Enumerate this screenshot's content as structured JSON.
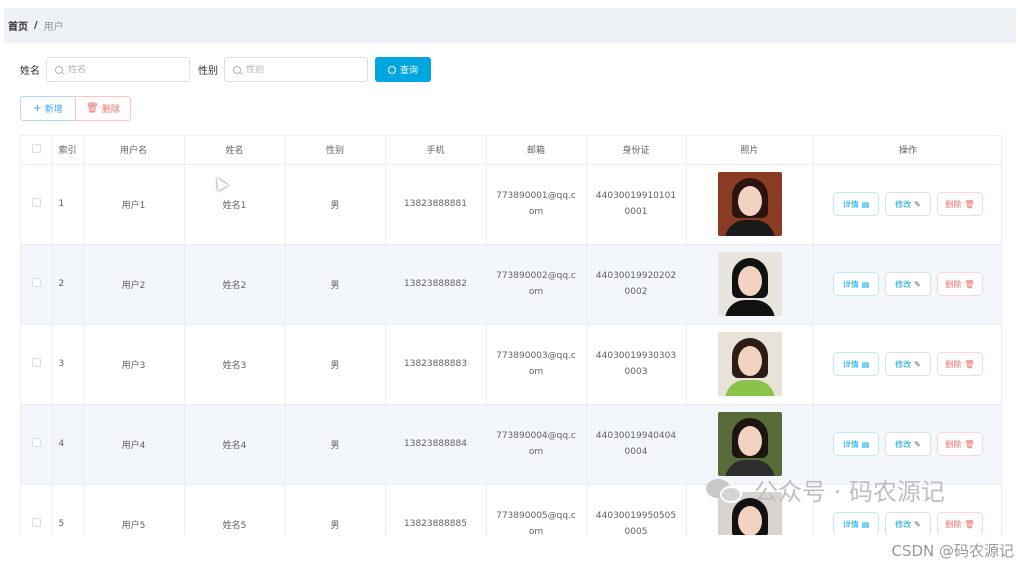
{
  "breadcrumb": {
    "home": "首页",
    "separator": "/",
    "current": "用户"
  },
  "search": {
    "name_label": "姓名",
    "name_placeholder": "姓名",
    "gender_label": "性别",
    "gender_placeholder": "性别",
    "query_label": "查询"
  },
  "actions": {
    "add_label": "新增",
    "delete_label": "删除"
  },
  "table": {
    "columns": [
      "索引",
      "用户名",
      "姓名",
      "性别",
      "手机",
      "邮箱",
      "身份证",
      "照片",
      "操作"
    ],
    "rows": [
      {
        "index": "1",
        "username": "用户1",
        "name": "姓名1",
        "gender": "男",
        "phone": "13823888881",
        "email": "773890001@qq.com",
        "idcard": "440300199101010001"
      },
      {
        "index": "2",
        "username": "用户2",
        "name": "姓名2",
        "gender": "男",
        "phone": "13823888882",
        "email": "773890002@qq.com",
        "idcard": "440300199202020002"
      },
      {
        "index": "3",
        "username": "用户3",
        "name": "姓名3",
        "gender": "男",
        "phone": "13823888883",
        "email": "773890003@qq.com",
        "idcard": "440300199303030003"
      },
      {
        "index": "4",
        "username": "用户4",
        "name": "姓名4",
        "gender": "男",
        "phone": "13823888884",
        "email": "773890004@qq.com",
        "idcard": "440300199404040004"
      },
      {
        "index": "5",
        "username": "用户5",
        "name": "姓名5",
        "gender": "男",
        "phone": "13823888885",
        "email": "773890005@qq.com",
        "idcard": "440300199505050005"
      }
    ],
    "row_actions": {
      "detail": "详情",
      "edit": "修改",
      "remove": "删除"
    }
  },
  "watermark": {
    "text": "公众号 · 码农源记",
    "csdn": "CSDN @码农源记"
  },
  "colors": {
    "primary": "#00a6e0",
    "danger": "#f56c6c",
    "stripe": "#f3f6fa"
  }
}
